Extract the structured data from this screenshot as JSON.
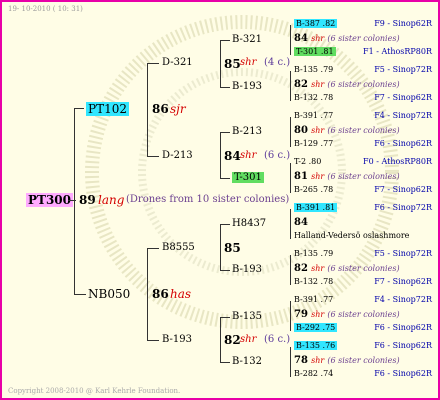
{
  "header_date": "19- 10-2010 ( 10: 31)",
  "footer": "Copyright 2008-2010 @ Karl Kehrle Foundation.",
  "colors": {
    "border": "#e800a8",
    "bg": "#fffde6",
    "cyan": "#31e6ff",
    "green": "#61dd61",
    "pink": "#ffaaff",
    "red": "#d40000"
  },
  "root": {
    "id": "PT300",
    "num": "89",
    "tag": "lang",
    "note": "(Drones from 10 sister colonies)"
  },
  "gen1": [
    {
      "id": "PT102",
      "num": "86",
      "tag": "sjr"
    },
    {
      "id": "NB050",
      "num": "86",
      "tag": "has"
    }
  ],
  "gen2": [
    {
      "id": "D-321",
      "num": "85",
      "tag": "shr",
      "note": "(4 c.)"
    },
    {
      "id": "D-213",
      "num": "84",
      "tag": "shr",
      "note": "(6 c.)"
    },
    {
      "id": "B8555",
      "num": "85"
    },
    {
      "id": "B-193",
      "num": "82",
      "tag": "shr",
      "note": "(6 c.)"
    }
  ],
  "gen3": [
    "B-321",
    "B-193",
    "B-213",
    "T-301",
    "H8437",
    "B-193",
    "B-135",
    "B-132"
  ],
  "gen4": [
    {
      "id": "B-387 .82",
      "right": "F9 - Sinop62R"
    },
    {
      "id": "B-135 .79",
      "right": "F5 - Sinop72R"
    },
    {
      "id": "B-391 .77",
      "right": "F4 - Sinop72R"
    },
    {
      "id": "T-2 .80",
      "right": "F0 - AthosRP80R"
    },
    {
      "id": "B-391 .81",
      "right": "F6 - Sinop72R"
    },
    {
      "id": "B-135 .79",
      "right": "F5 - Sinop72R"
    },
    {
      "id": "B-391 .77",
      "right": "F4 - Sinop72R"
    },
    {
      "id": "B-135 .76",
      "right": "F6 - Sinop62R"
    }
  ],
  "gen4_mid": [
    {
      "num": "84",
      "tag": "shr",
      "note": "(6 sister colonies)"
    },
    {
      "num": "82",
      "tag": "shr",
      "note": "(6 sister colonies)"
    },
    {
      "num": "80",
      "tag": "shr",
      "note": "(6 sister colonies)"
    },
    {
      "num": "81",
      "tag": "shr",
      "note": "(6 sister colonies)"
    },
    {
      "num": "84",
      "tag": "",
      "note": ""
    },
    {
      "num": "82",
      "tag": "shr",
      "note": "(6 sister colonies)"
    },
    {
      "num": "79",
      "tag": "shr",
      "note": "(6 sister colonies)"
    },
    {
      "num": "78",
      "tag": "shr",
      "note": "(6 sister colonies)"
    }
  ],
  "gen4_low": [
    {
      "id": "T-301 .81",
      "right": "F1 - AthosRP80R"
    },
    {
      "id": "B-132 .78",
      "right": "F7 - Sinop62R"
    },
    {
      "id": "B-129 .77",
      "right": "F6 - Sinop62R"
    },
    {
      "id": "B-265 .78",
      "right": "F7 - Sinop62R"
    },
    {
      "id": "Halland-Vedersö oslashmore",
      "right": ""
    },
    {
      "id": "B-132 .78",
      "right": "F7 - Sinop62R"
    },
    {
      "id": "B-292 .75",
      "right": "F6 - Sinop62R"
    },
    {
      "id": "B-282 .74",
      "right": "F6 - Sinop62R"
    }
  ]
}
